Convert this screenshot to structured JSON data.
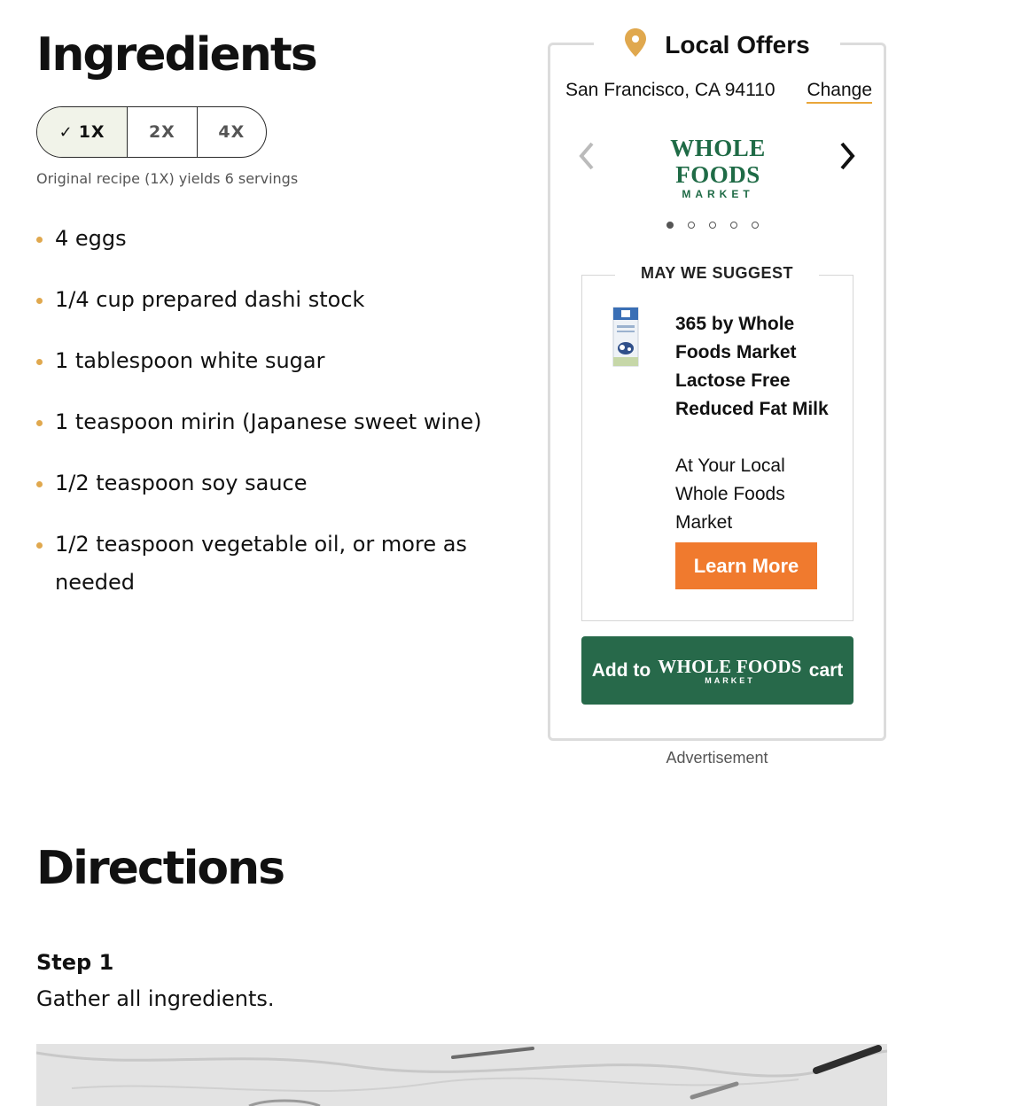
{
  "ingredients": {
    "title": "Ingredients",
    "scale_options": [
      {
        "label": "1X",
        "selected": true
      },
      {
        "label": "2X",
        "selected": false
      },
      {
        "label": "4X",
        "selected": false
      }
    ],
    "yield_note": "Original recipe (1X) yields 6 servings",
    "items": [
      "4 eggs",
      "1/4 cup prepared dashi stock",
      "1 tablespoon white sugar",
      "1 teaspoon mirin (Japanese sweet wine)",
      "1/2 teaspoon soy sauce",
      "1/2 teaspoon vegetable oil, or more as needed"
    ],
    "bullet_color": "#e0a84e"
  },
  "ad": {
    "header": "Local Offers",
    "location": "San Francisco, CA 94110",
    "change_label": "Change",
    "logo": {
      "line1": "WHOLE FOODS",
      "line2": "MARKET"
    },
    "carousel": {
      "slide_count": 5,
      "active_index": 0
    },
    "suggest_title": "MAY WE SUGGEST",
    "product_name": "365 by Whole Foods Market Lactose Free Reduced Fat Milk",
    "product_sub": "At Your Local Whole Foods Market",
    "learn_more_label": "Learn More",
    "cart": {
      "prefix": "Add to",
      "suffix": "cart",
      "logo_line1": "WHOLE FOODS",
      "logo_line2": "MARKET"
    },
    "footer_label": "Advertisement",
    "colors": {
      "brand_green": "#27694a",
      "cta_orange": "#f07a2e",
      "accent_gold": "#e9a63a"
    }
  },
  "directions": {
    "title": "Directions",
    "steps": [
      {
        "label": "Step 1",
        "text": "Gather all ingredients."
      }
    ]
  }
}
